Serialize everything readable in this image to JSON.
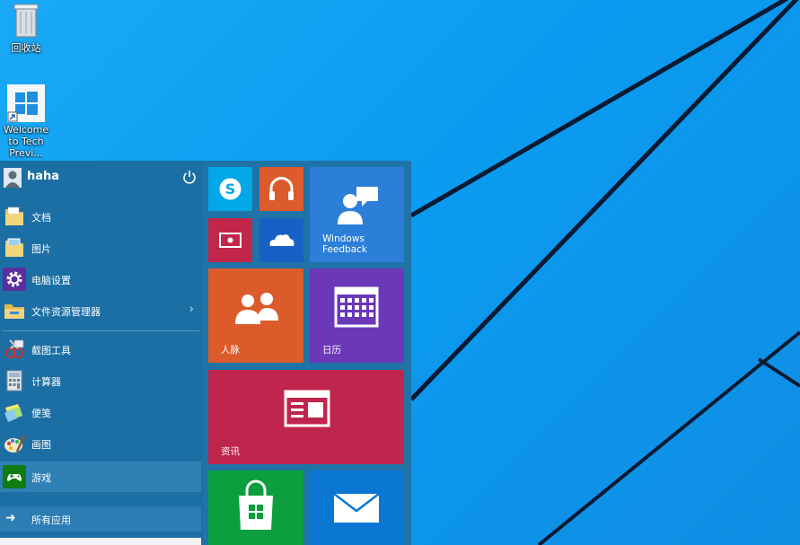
{
  "desktop": {
    "icons": [
      {
        "label": "回收站",
        "icon": "recycle-bin-icon"
      },
      {
        "label": "Welcome to Tech Previ...",
        "icon": "windows-logo-icon"
      }
    ]
  },
  "start_menu": {
    "user": {
      "name": "haha",
      "icon": "user-avatar-icon"
    },
    "power_icon": "power-icon",
    "places": [
      {
        "label": "文档",
        "icon": "folder-documents-icon"
      },
      {
        "label": "图片",
        "icon": "folder-pictures-icon"
      },
      {
        "label": "电脑设置",
        "icon": "gear-icon"
      },
      {
        "label": "文件资源管理器",
        "icon": "file-explorer-icon",
        "has_submenu": true
      }
    ],
    "apps": [
      {
        "label": "截图工具",
        "icon": "snipping-tool-icon"
      },
      {
        "label": "计算器",
        "icon": "calculator-icon"
      },
      {
        "label": "便笺",
        "icon": "sticky-notes-icon"
      },
      {
        "label": "画图",
        "icon": "paint-icon"
      },
      {
        "label": "游戏",
        "icon": "games-controller-icon",
        "selected": true
      }
    ],
    "all_apps_label": "所有应用",
    "tiles": {
      "skype": {
        "label": "",
        "icon": "skype-icon"
      },
      "music": {
        "label": "",
        "icon": "headphones-icon"
      },
      "video": {
        "label": "",
        "icon": "video-icon"
      },
      "onedrive": {
        "label": "",
        "icon": "cloud-icon"
      },
      "feedback": {
        "label": "Windows Feedback",
        "icon": "feedback-person-icon"
      },
      "people": {
        "label": "人脉",
        "icon": "people-icon"
      },
      "calendar": {
        "label": "日历",
        "icon": "calendar-icon"
      },
      "news": {
        "label": "资讯",
        "icon": "news-icon"
      },
      "store": {
        "label": "",
        "icon": "store-bag-icon"
      },
      "mail": {
        "label": "",
        "icon": "mail-envelope-icon"
      }
    }
  },
  "colors": {
    "desktop_blue": "#0a9cf0",
    "start_bg": "#1b6fa4",
    "skype": "#00a8e8",
    "music": "#dc5a2c",
    "video": "#c2264a",
    "onedrive": "#1761c4",
    "feedback": "#2c7fd8",
    "people": "#db5b2b",
    "calendar": "#6b38b8",
    "news": "#c0254d",
    "store": "#0d9e3e",
    "mail": "#0a78d2"
  }
}
